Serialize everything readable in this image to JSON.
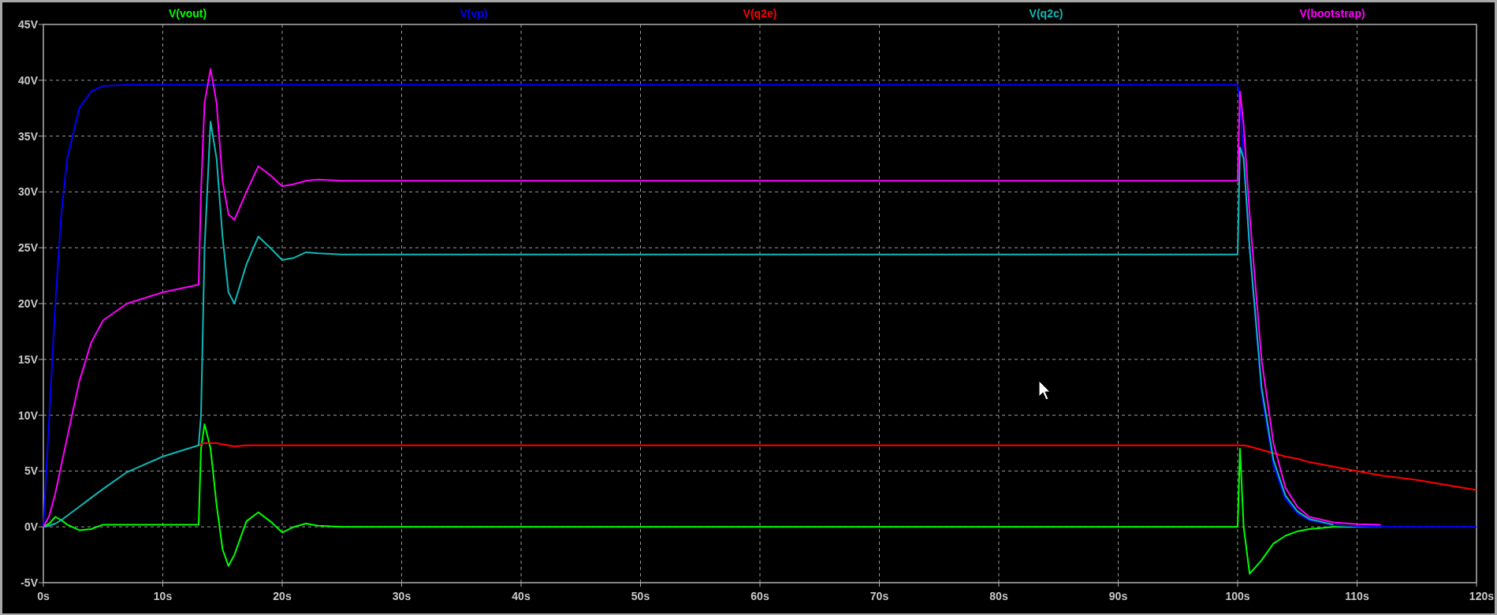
{
  "plot": {
    "chart_data": {
      "type": "line",
      "grid": true,
      "xlim": [
        0,
        120
      ],
      "ylim": [
        -5,
        45
      ],
      "xticks": [
        {
          "value": 0,
          "label": "0s"
        },
        {
          "value": 10,
          "label": "10s"
        },
        {
          "value": 20,
          "label": "20s"
        },
        {
          "value": 30,
          "label": "30s"
        },
        {
          "value": 40,
          "label": "40s"
        },
        {
          "value": 50,
          "label": "50s"
        },
        {
          "value": 60,
          "label": "60s"
        },
        {
          "value": 70,
          "label": "70s"
        },
        {
          "value": 80,
          "label": "80s"
        },
        {
          "value": 90,
          "label": "90s"
        },
        {
          "value": 100,
          "label": "100s"
        },
        {
          "value": 110,
          "label": "110s"
        },
        {
          "value": 120,
          "label": "120s"
        }
      ],
      "yticks": [
        {
          "value": 45,
          "label": "45V"
        },
        {
          "value": 40,
          "label": "40V"
        },
        {
          "value": 35,
          "label": "35V"
        },
        {
          "value": 30,
          "label": "30V"
        },
        {
          "value": 25,
          "label": "25V"
        },
        {
          "value": 20,
          "label": "20V"
        },
        {
          "value": 15,
          "label": "15V"
        },
        {
          "value": 10,
          "label": "10V"
        },
        {
          "value": 5,
          "label": "5V"
        },
        {
          "value": 0,
          "label": "0V"
        },
        {
          "value": -5,
          "label": "-5V"
        }
      ],
      "x": [
        0,
        0.5,
        1,
        1.5,
        2,
        3,
        4,
        5,
        7,
        10,
        13,
        13.2,
        13.5,
        14,
        14.5,
        15,
        15.5,
        16,
        17,
        18,
        19,
        20,
        21,
        22,
        23,
        25,
        30,
        50,
        100,
        100.2,
        100.5,
        101,
        102,
        103,
        104,
        105,
        106,
        108,
        110,
        112,
        115,
        120
      ],
      "series": [
        {
          "name": "V(vout)",
          "color": "#00ff00",
          "values": [
            0,
            0.3,
            0.9,
            0.6,
            0.2,
            -0.3,
            -0.2,
            0.2,
            0.2,
            0.2,
            0.2,
            7,
            9.2,
            7,
            2,
            -2,
            -3.5,
            -2.5,
            0.5,
            1.3,
            0.5,
            -0.5,
            0,
            0.3,
            0.1,
            0,
            0,
            0,
            0,
            7,
            0,
            -4.2,
            -3,
            -1.5,
            -0.8,
            -0.4,
            -0.2,
            0,
            0,
            0,
            null,
            null
          ]
        },
        {
          "name": "V(vp)",
          "color": "#0000ff",
          "values": [
            0,
            10,
            20,
            28,
            33,
            37.5,
            39,
            39.5,
            39.6,
            39.6,
            39.6,
            39.6,
            39.6,
            39.6,
            39.6,
            39.6,
            39.6,
            39.6,
            39.6,
            39.6,
            39.6,
            39.6,
            39.6,
            39.6,
            39.6,
            39.6,
            39.6,
            39.6,
            39.6,
            38,
            33,
            25,
            12,
            5.5,
            2.5,
            1.2,
            0.6,
            0.15,
            0.05,
            0,
            0,
            0
          ]
        },
        {
          "name": "V(q2e)",
          "color": "#ff0000",
          "values": [
            null,
            null,
            null,
            null,
            null,
            null,
            null,
            null,
            null,
            null,
            7.3,
            7.4,
            7.5,
            7.5,
            7.5,
            7.4,
            7.3,
            7.2,
            7.3,
            7.3,
            7.3,
            7.3,
            7.3,
            7.3,
            7.3,
            7.3,
            7.3,
            7.3,
            7.3,
            7.3,
            7.3,
            7.2,
            6.9,
            6.6,
            6.3,
            6.1,
            5.8,
            5.4,
            5,
            4.6,
            4.2,
            3.3
          ]
        },
        {
          "name": "V(q2c)",
          "color": "#10b8b8",
          "values": [
            0,
            0.1,
            0.3,
            0.6,
            1,
            1.8,
            2.6,
            3.4,
            4.9,
            6.3,
            7.3,
            10,
            25,
            36.3,
            33,
            26,
            21,
            20,
            23.5,
            26,
            25,
            23.9,
            24.1,
            24.6,
            24.5,
            24.4,
            24.4,
            24.4,
            24.4,
            34,
            33,
            25,
            12.5,
            6,
            2.8,
            1.4,
            0.7,
            0.2,
            null,
            null,
            null,
            null
          ]
        },
        {
          "name": "V(bootstrap)",
          "color": "#ff00ff",
          "values": [
            0,
            1,
            3,
            5.5,
            8,
            13,
            16.5,
            18.5,
            20,
            21,
            21.7,
            30,
            38,
            41,
            38,
            31,
            28,
            27.5,
            30,
            32.3,
            31.5,
            30.5,
            30.7,
            31,
            31.1,
            31,
            31,
            31,
            31,
            39,
            36,
            28,
            15,
            7.5,
            3.5,
            1.8,
            0.9,
            0.4,
            0.25,
            0.2,
            null,
            null
          ]
        }
      ]
    }
  }
}
